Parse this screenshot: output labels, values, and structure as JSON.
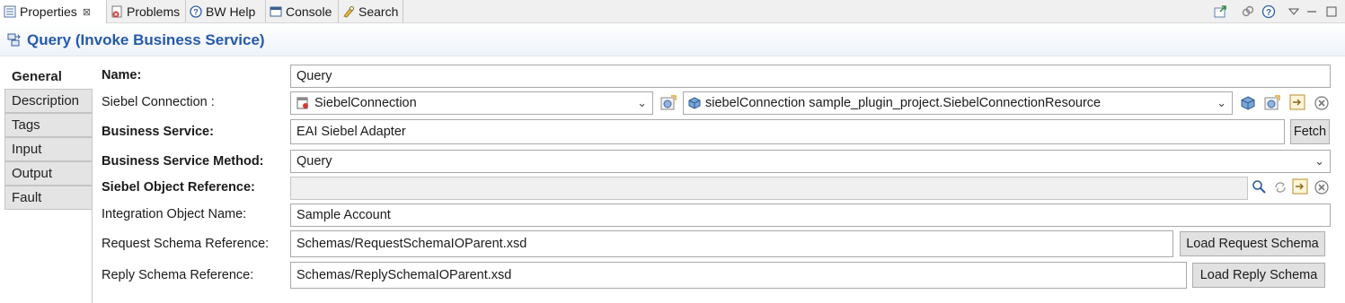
{
  "tabs": [
    {
      "label": "Properties",
      "close": "⊠",
      "icon": "properties-icon"
    },
    {
      "label": "Problems",
      "icon": "problems-icon"
    },
    {
      "label": "BW Help",
      "icon": "help-icon"
    },
    {
      "label": "Console",
      "icon": "console-icon"
    },
    {
      "label": "Search",
      "icon": "search-icon"
    }
  ],
  "header": {
    "title": "Query (Invoke Business Service)",
    "icon": "activity-icon"
  },
  "side_tabs": [
    "General",
    "Description",
    "Tags",
    "Input",
    "Output",
    "Fault"
  ],
  "form": {
    "name_label": "Name:",
    "name_value": "Query",
    "connection_label": "Siebel Connection :",
    "connection_value": "SiebelConnection",
    "connection_resource": "siebelConnection sample_plugin_project.SiebelConnectionResource",
    "business_service_label": "Business Service:",
    "business_service_value": "EAI Siebel Adapter",
    "fetch_label": "Fetch",
    "method_label": "Business Service Method:",
    "method_value": "Query",
    "object_ref_label": "Siebel Object Reference:",
    "object_ref_value": "",
    "integration_label": "Integration Object Name:",
    "integration_value": "Sample Account",
    "request_label": "Request Schema Reference:",
    "request_value": "Schemas/RequestSchemaIOParent.xsd",
    "load_request_label": "Load Request Schema",
    "reply_label": "Reply Schema Reference:",
    "reply_value": "Schemas/ReplySchemaIOParent.xsd",
    "load_reply_label": "Load Reply Schema"
  },
  "colors": {
    "title": "#255aa8",
    "tab_strip": "#f0f0f0",
    "side_tab": "#e4e4e4"
  }
}
